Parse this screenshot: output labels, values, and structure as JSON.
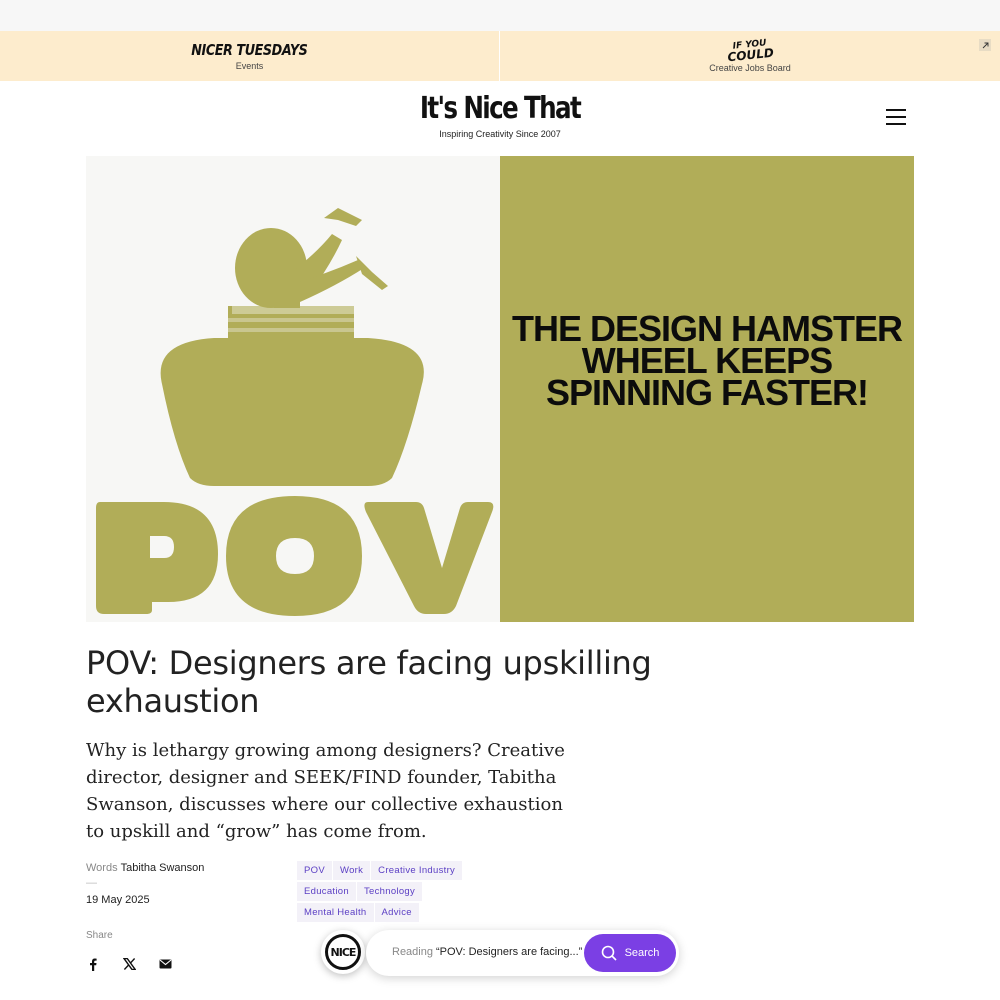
{
  "promo_bar": {
    "left": {
      "logo": "NICER TUESDAYS",
      "label": "Events"
    },
    "right": {
      "logo_lines": [
        "IF YOU",
        "COULD"
      ],
      "label": "Creative Jobs Board"
    },
    "external_icon": "arrow-up-right-icon"
  },
  "masthead": {
    "logo": "It's Nice That",
    "tagline": "Inspiring Creativity Since 2007",
    "menu_icon": "hamburger-menu-icon"
  },
  "hero": {
    "left_text": "POV",
    "quote_lines": [
      "THE DESIGN HAMSTER",
      "WHEEL KEEPS",
      "SPINNING FASTER!"
    ],
    "colors": {
      "olive": "#b1ad58",
      "panel_bg": "#f7f7f5"
    }
  },
  "article": {
    "title": "POV: Designers are facing upskilling exhaustion",
    "standfirst": "Why is lethargy growing among designers? Creative director, designer and SEEK/FIND founder, Tabitha Swanson, discusses where our collective exhaustion to upskill and “grow” has come from.",
    "words_label": "Words",
    "author": "Tabitha Swanson",
    "dash": "—",
    "date": "19 May 2025",
    "share_label": "Share",
    "share_icons": [
      "facebook-icon",
      "x-twitter-icon",
      "email-icon"
    ]
  },
  "tags": [
    [
      "POV",
      "Work",
      "Creative Industry"
    ],
    [
      "Education",
      "Technology"
    ],
    [
      "Mental Health",
      "Advice"
    ]
  ],
  "reading_bar": {
    "badge": "NICE",
    "reading_label": "Reading",
    "article_title": "“POV: Designers are facing...”",
    "search_label": "Search",
    "accent": "#7b3fe4"
  }
}
